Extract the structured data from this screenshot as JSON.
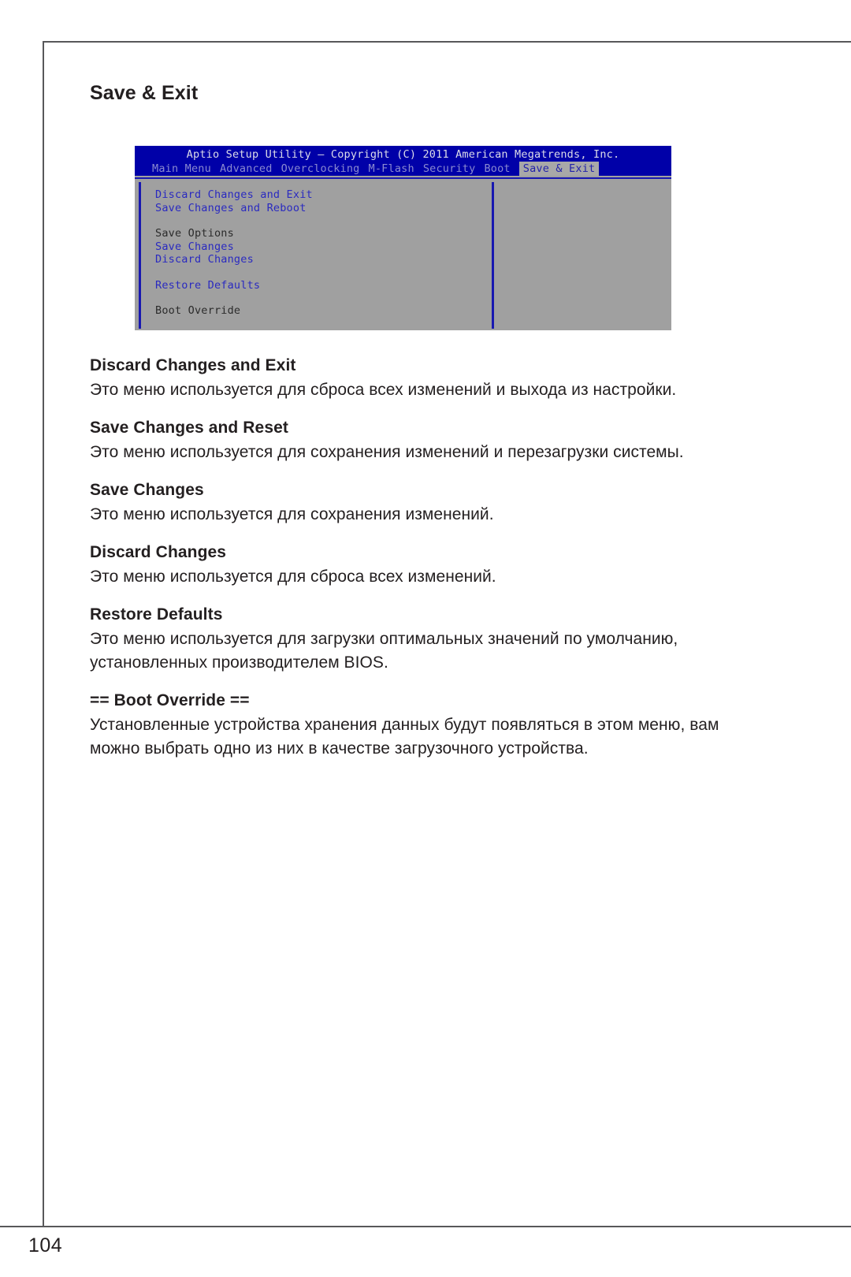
{
  "page": {
    "number": "104",
    "section_title": "Save & Exit"
  },
  "bios": {
    "title": "Aptio Setup Utility – Copyright (C) 2011 American Megatrends, Inc.",
    "menu": [
      {
        "label": "Main Menu",
        "active": false
      },
      {
        "label": "Advanced",
        "active": false
      },
      {
        "label": "Overclocking",
        "active": false
      },
      {
        "label": "M-Flash",
        "active": false
      },
      {
        "label": "Security",
        "active": false
      },
      {
        "label": "Boot",
        "active": false
      },
      {
        "label": "Save & Exit",
        "active": true
      }
    ],
    "items": [
      {
        "label": "Discard Changes and Exit",
        "kind": "option"
      },
      {
        "label": "Save Changes and Reboot",
        "kind": "option"
      },
      {
        "label": "",
        "kind": "gap"
      },
      {
        "label": "Save Options",
        "kind": "header"
      },
      {
        "label": "Save Changes",
        "kind": "option"
      },
      {
        "label": "Discard Changes",
        "kind": "option"
      },
      {
        "label": "",
        "kind": "gap"
      },
      {
        "label": "Restore Defaults",
        "kind": "option"
      },
      {
        "label": "",
        "kind": "gap"
      },
      {
        "label": "Boot Override",
        "kind": "header"
      }
    ],
    "colors": {
      "titlebar": "#0000a8",
      "background": "#a0a0a0",
      "option_text": "#2a2ac0",
      "header_text": "#2b2b2b",
      "border": "#1818b0"
    }
  },
  "descriptions": [
    {
      "heading": "Discard Changes and Exit",
      "body": "Это меню используется для сброса всех изменений и выхода из настройки."
    },
    {
      "heading": "Save Changes and Reset",
      "body": "Это меню используется для сохранения изменений и перезагрузки системы."
    },
    {
      "heading": "Save Changes",
      "body": "Это меню используется для сохранения изменений."
    },
    {
      "heading": "Discard Changes",
      "body": "Это меню используется для сброса всех изменений."
    },
    {
      "heading": "Restore Defaults",
      "body": "Это меню используется для загрузки оптимальных значений по умолчанию, установленных производителем BIOS."
    },
    {
      "heading": "== Boot Override ==",
      "body": "Установленные устройства хранения данных будут появляться в этом меню, вам можно выбрать одно из них в качестве загрузочного устройства."
    }
  ]
}
